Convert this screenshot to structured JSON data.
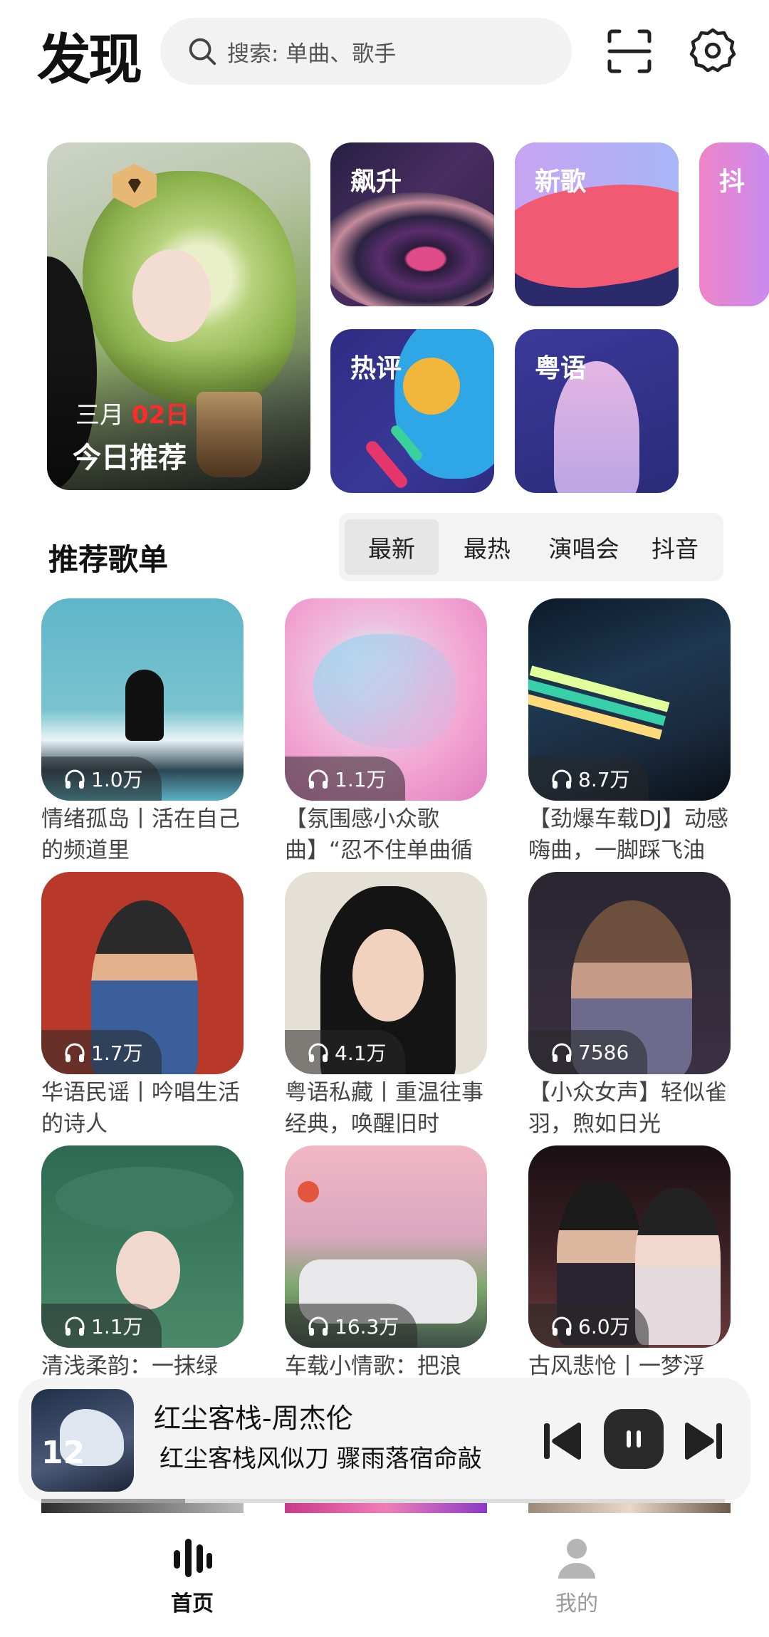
{
  "header": {
    "title": "发现",
    "search_placeholder": "搜索: 单曲、歌手",
    "icons": [
      "search-icon",
      "scan-icon",
      "settings-icon"
    ]
  },
  "feature": {
    "daily": {
      "month": "三月",
      "day": "02日",
      "label": "今日推荐"
    },
    "tiles": [
      "飙升",
      "新歌",
      "热评",
      "粤语",
      "抖"
    ]
  },
  "section": {
    "title": "推荐歌单",
    "tabs": [
      "最新",
      "最热",
      "演唱会",
      "抖音"
    ],
    "active_tab": "最新"
  },
  "playlists": [
    {
      "count": "1.0万",
      "name": "情绪孤岛丨活在自己的频道里"
    },
    {
      "count": "1.1万",
      "name": "【氛围感小众歌曲】“忍不住单曲循环！”"
    },
    {
      "count": "8.7万",
      "name": "【劲爆车载DJ】动感嗨曲，一脚踩飞油"
    },
    {
      "count": "1.7万",
      "name": "华语民谣丨吟唱生活的诗人"
    },
    {
      "count": "4.1万",
      "name": "粤语私藏丨重温往事经典，唤醒旧时"
    },
    {
      "count": "7586",
      "name": "【小众女声】轻似雀羽，煦如日光"
    },
    {
      "count": "1.1万",
      "name": "清浅柔韵：一抹绿"
    },
    {
      "count": "16.3万",
      "name": "车载小情歌：把浪"
    },
    {
      "count": "6.0万",
      "name": "古风悲怆丨一梦浮"
    }
  ],
  "player": {
    "song": "红尘客栈-周杰伦",
    "lyric": "红尘客栈风似刀 骤雨落宿命敲",
    "art_text": "12",
    "progress": 0.21
  },
  "nav": {
    "home": "首页",
    "me": "我的",
    "active": "home"
  },
  "colors": {
    "accent": "#111111",
    "date_highlight": "#ff2a2a",
    "inactive": "#9a9a9a"
  }
}
